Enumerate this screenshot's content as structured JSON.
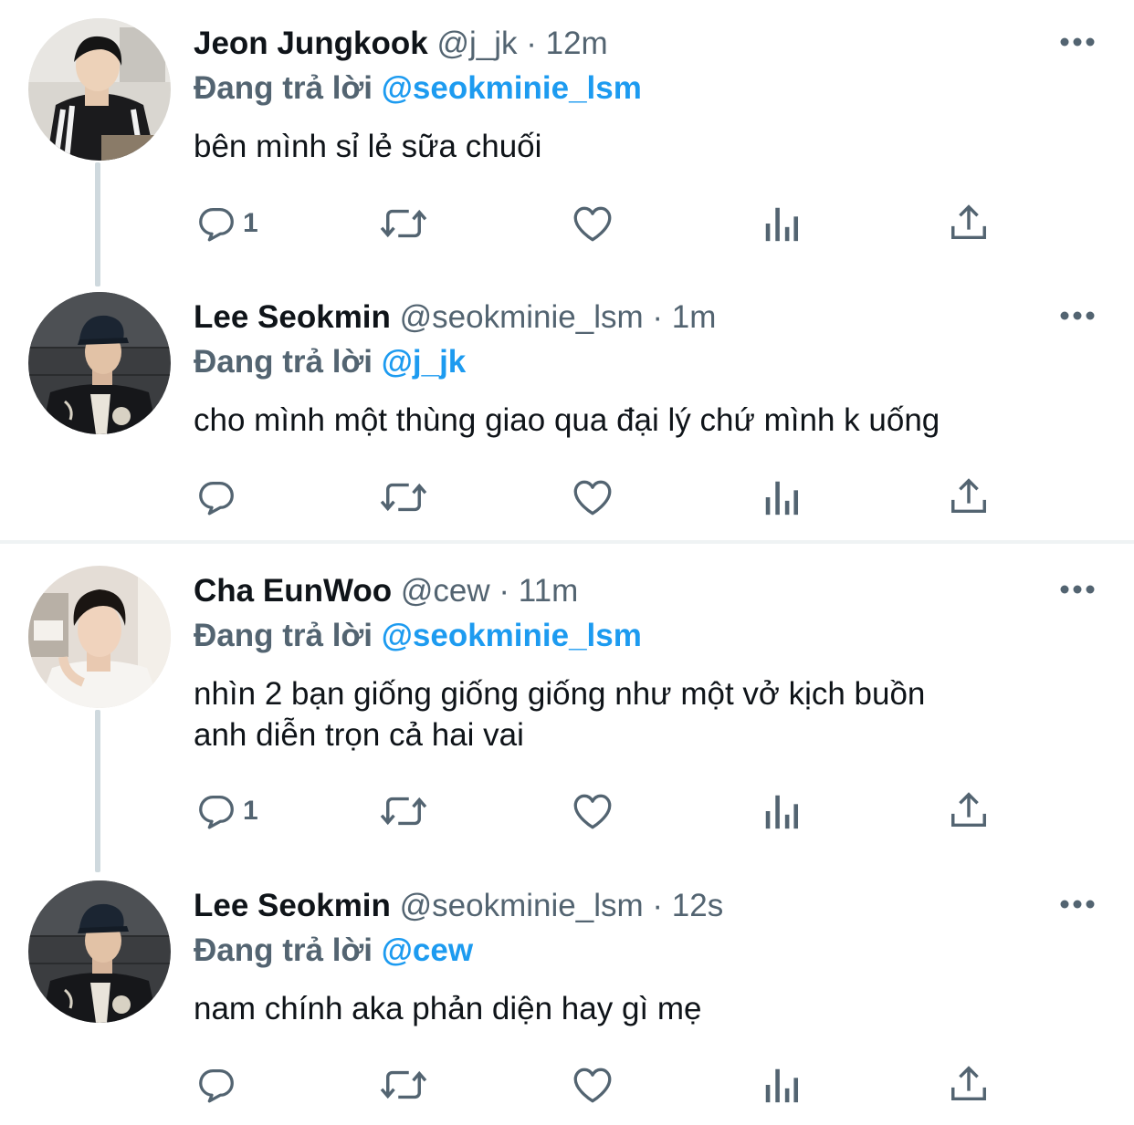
{
  "threads": [
    {
      "tweets": [
        {
          "name": "Jeon Jungkook",
          "handle": "@j_jk",
          "dot": "·",
          "time": "12m",
          "reply_prefix": "Đang trả lời",
          "reply_handle": "@seokminie_lsm",
          "text": "bên mình sỉ lẻ sữa chuối",
          "reply_count": "1",
          "avatar": "avatar-jungkook"
        },
        {
          "name": "Lee Seokmin",
          "handle": "@seokminie_lsm",
          "dot": "·",
          "time": "1m",
          "reply_prefix": "Đang trả lời",
          "reply_handle": "@j_jk",
          "text": "cho mình một thùng giao qua đại lý chứ mình k uống",
          "reply_count": "",
          "avatar": "avatar-seokmin"
        }
      ]
    },
    {
      "tweets": [
        {
          "name": "Cha EunWoo",
          "handle": "@cew",
          "dot": "·",
          "time": "11m",
          "reply_prefix": "Đang trả lời",
          "reply_handle": "@seokminie_lsm",
          "text": "nhìn 2 bạn giống giống giống như một vở kịch buồn\nanh diễn trọn cả hai vai",
          "reply_count": "1",
          "avatar": "avatar-eunwoo"
        },
        {
          "name": "Lee Seokmin",
          "handle": "@seokminie_lsm",
          "dot": "·",
          "time": "12s",
          "reply_prefix": "Đang trả lời",
          "reply_handle": "@cew",
          "text": "nam chính aka phản diện hay gì mẹ",
          "reply_count": "",
          "avatar": "avatar-seokmin"
        }
      ]
    }
  ],
  "icons": {
    "reply": "reply-icon",
    "retweet": "retweet-icon",
    "like": "heart-icon",
    "analytics": "analytics-icon",
    "share": "share-icon",
    "more": "more-icon"
  },
  "colors": {
    "text": "#0f1419",
    "muted": "#536471",
    "link": "#1d9bf0",
    "connector": "#cfd9de",
    "divider": "#eff3f4"
  }
}
